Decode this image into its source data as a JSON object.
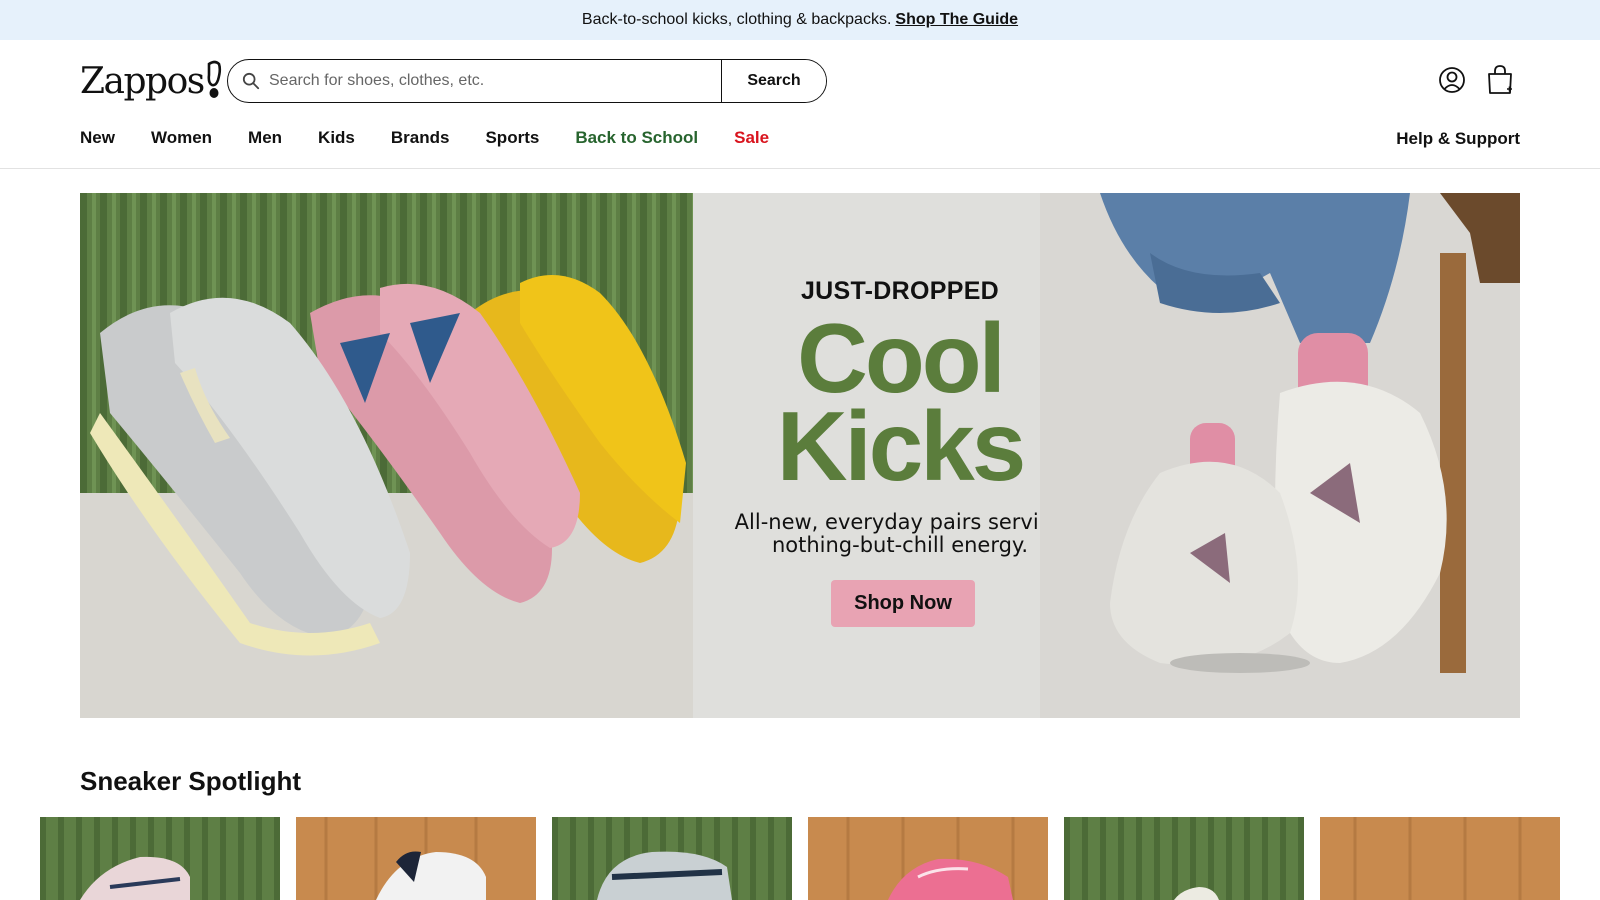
{
  "promo": {
    "text": "Back-to-school kicks, clothing & backpacks.",
    "link": "Shop The Guide"
  },
  "header": {
    "logo_text": "Zappos",
    "search": {
      "placeholder": "Search for shoes, clothes, etc.",
      "value": "",
      "button": "Search"
    },
    "icons": [
      "user-icon",
      "shopping-bag-icon"
    ]
  },
  "nav": {
    "items": [
      {
        "label": "New",
        "color": "#111111"
      },
      {
        "label": "Women",
        "color": "#111111"
      },
      {
        "label": "Men",
        "color": "#111111"
      },
      {
        "label": "Kids",
        "color": "#111111"
      },
      {
        "label": "Brands",
        "color": "#111111"
      },
      {
        "label": "Sports",
        "color": "#111111"
      },
      {
        "label": "Back to School",
        "color": "#27642e"
      },
      {
        "label": "Sale",
        "color": "#d9141e"
      }
    ],
    "help": "Help & Support"
  },
  "hero": {
    "eyebrow": "JUST-DROPPED",
    "headline_line1": "Cool",
    "headline_line2": "Kicks",
    "subtext": "All-new, everyday pairs serving nothing-but-chill energy.",
    "cta": "Shop Now",
    "colors": {
      "headline": "#5b7d3c",
      "cta_bg": "#e8a3b3"
    }
  },
  "spotlight": {
    "title": "Sneaker Spotlight",
    "tiles": [
      {
        "background": "green-slats",
        "shoe_color": "#e9d6d8"
      },
      {
        "background": "wood",
        "shoe_color": "#f2f2f2"
      },
      {
        "background": "green-slats",
        "shoe_color": "#c9d0d3"
      },
      {
        "background": "wood",
        "shoe_color": "#ec6f92"
      },
      {
        "background": "green-slats",
        "shoe_color": "#ecebe2"
      },
      {
        "background": "wood",
        "shoe_color": ""
      }
    ]
  }
}
